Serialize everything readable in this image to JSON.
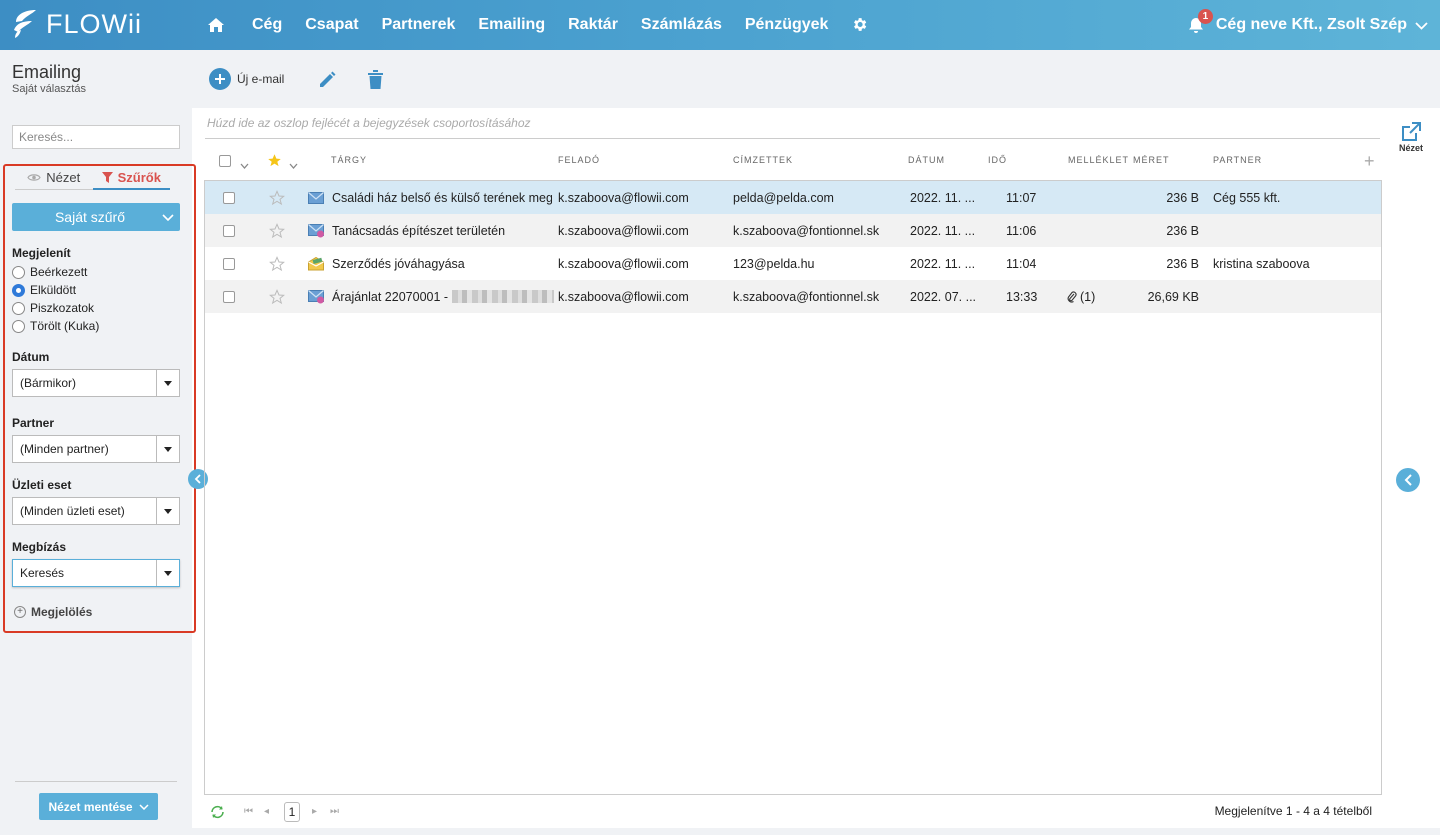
{
  "header": {
    "logo_text": "FLOWii",
    "nav": [
      "Cég",
      "Csapat",
      "Partnerek",
      "Emailing",
      "Raktár",
      "Számlázás",
      "Pénzügyek"
    ],
    "notification_count": "1",
    "account_name": "Cég neve Kft., Zsolt Szép",
    "brand_color": "#4aa0cf"
  },
  "page": {
    "title": "Emailing",
    "subtitle": "Saját választás"
  },
  "toolbar": {
    "new_email_label": "Új e-mail"
  },
  "sidebar": {
    "search_placeholder": "Keresés...",
    "tabs": {
      "view": "Nézet",
      "filters": "Szűrők"
    },
    "own_filter_label": "Saját szűrő",
    "display_label": "Megjelenít",
    "display_options": [
      {
        "label": "Beérkezett",
        "checked": false
      },
      {
        "label": "Elküldött",
        "checked": true
      },
      {
        "label": "Piszkozatok",
        "checked": false
      },
      {
        "label": "Törölt (Kuka)",
        "checked": false
      }
    ],
    "date_label": "Dátum",
    "date_value": "(Bármikor)",
    "partner_label": "Partner",
    "partner_value": "(Minden partner)",
    "business_case_label": "Üzleti eset",
    "business_case_value": "(Minden üzleti eset)",
    "assignment_label": "Megbízás",
    "assignment_value": "Keresés",
    "marking_label": "Megjelölés",
    "save_view_label": "Nézet mentése",
    "highlight_color": "#d93a25"
  },
  "grid": {
    "group_hint": "Húzd ide az oszlop fejlécét a bejegyzések csoportosításához",
    "columns": {
      "subject": "TÁRGY",
      "sender": "FELADÓ",
      "recipients": "CÍMZETTEK",
      "date": "DÁTUM",
      "time": "IDŐ",
      "attachment": "MELLÉKLET",
      "size": "MÉRET",
      "partner": "PARTNER"
    },
    "rows": [
      {
        "subject": "Családi ház belső és külső terének megte",
        "sender": "k.szaboova@flowii.com",
        "recipients": "pelda@pelda.com",
        "date": "2022. 11. ...",
        "time": "11:07",
        "attachment": "",
        "size": "236 B",
        "partner": "Cég 555 kft.",
        "icon": "envelope-icon"
      },
      {
        "subject": "Tanácsadás építészet területén",
        "sender": "k.szaboova@flowii.com",
        "recipients": "k.szaboova@fontionnel.sk",
        "date": "2022. 11. ...",
        "time": "11:06",
        "attachment": "",
        "size": "236 B",
        "partner": "",
        "icon": "envelope-badge-icon"
      },
      {
        "subject": "Szerződés jóváhagyása",
        "sender": "k.szaboova@flowii.com",
        "recipients": "123@pelda.hu",
        "date": "2022. 11. ...",
        "time": "11:04",
        "attachment": "",
        "size": "236 B",
        "partner": "kristina szaboova",
        "icon": "envelope-open-icon"
      },
      {
        "subject": "Árajánlat 22070001 -",
        "sender": "k.szaboova@flowii.com",
        "recipients": "k.szaboova@fontionnel.sk",
        "date": "2022. 07. ...",
        "time": "13:33",
        "attachment": "(1)",
        "size": "26,69 KB",
        "partner": "",
        "icon": "envelope-badge-icon"
      }
    ]
  },
  "pager": {
    "page": "1",
    "info": "Megjelenítve 1 - 4 a 4 tételből"
  },
  "right_panel": {
    "view_label": "Nézet"
  }
}
